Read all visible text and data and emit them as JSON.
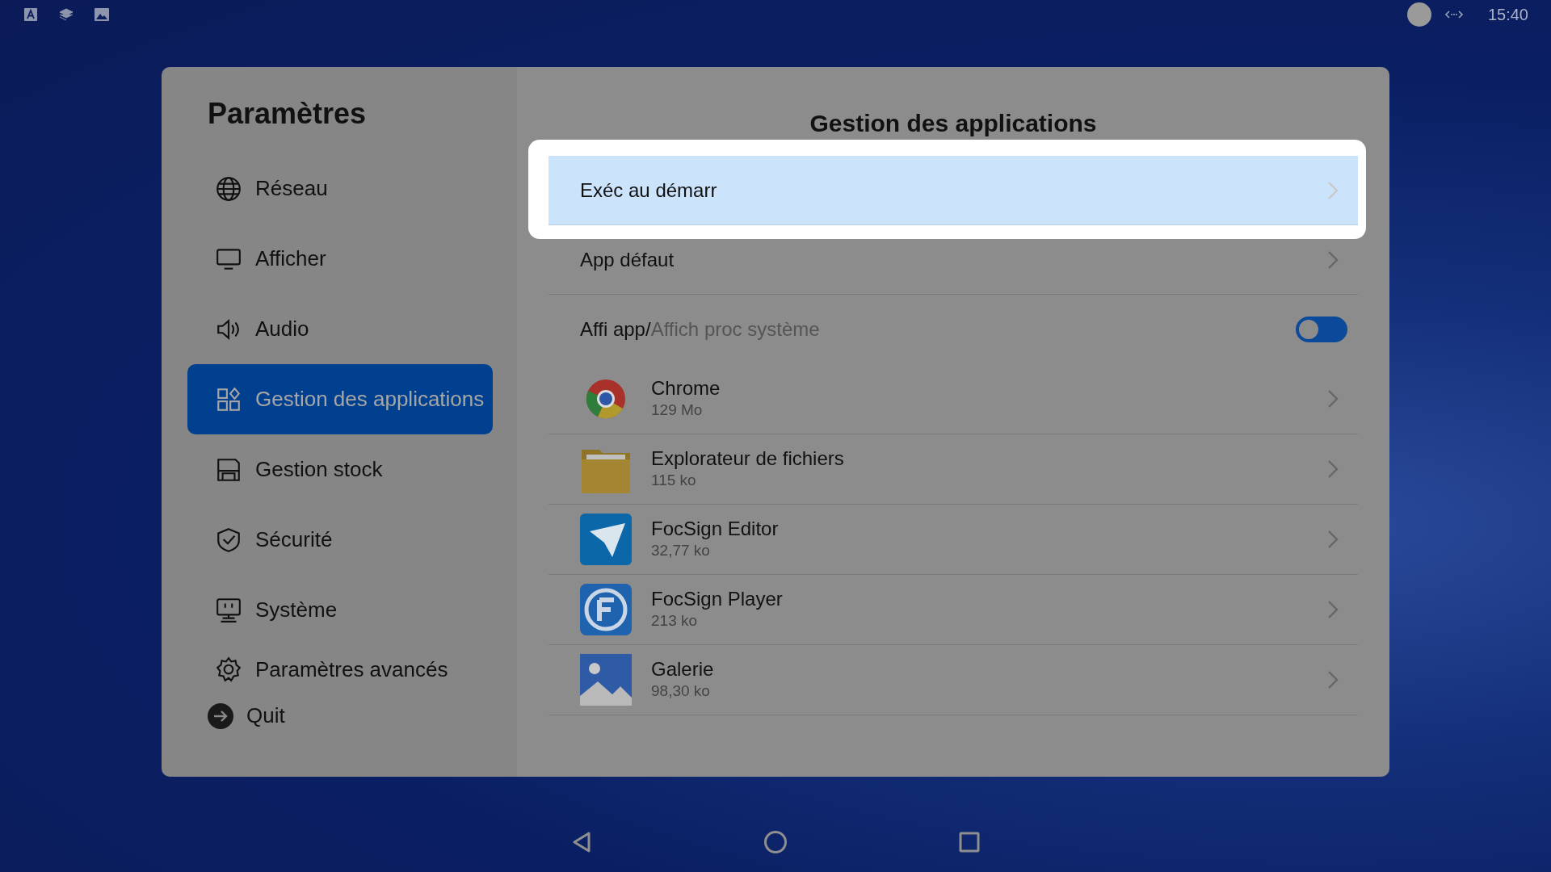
{
  "status_bar": {
    "time": "15:40"
  },
  "sidebar": {
    "title": "Paramètres",
    "items": [
      {
        "label": "Réseau",
        "selected": false
      },
      {
        "label": "Afficher",
        "selected": false
      },
      {
        "label": "Audio",
        "selected": false
      },
      {
        "label": "Gestion des applications",
        "selected": true
      },
      {
        "label": "Gestion stock",
        "selected": false
      },
      {
        "label": "Sécurité",
        "selected": false
      },
      {
        "label": "Système",
        "selected": false
      },
      {
        "label": "Paramètres avancés",
        "selected": false
      }
    ],
    "quit": "Quit"
  },
  "main": {
    "title": "Gestion des applications",
    "rows": [
      {
        "kind": "link",
        "label": "Exéc au démarr",
        "highlighted": true
      },
      {
        "kind": "link",
        "label": "App défaut",
        "highlighted": false
      },
      {
        "kind": "toggle",
        "label": "Affi app/",
        "sublabel": "Affich proc système",
        "on": false
      }
    ],
    "apps": [
      {
        "name": "Chrome",
        "size": "129 Mo"
      },
      {
        "name": "Explorateur de fichiers",
        "size": "115 ko"
      },
      {
        "name": "FocSign Editor",
        "size": "32,77 ko"
      },
      {
        "name": "FocSign Player",
        "size": "213 ko"
      },
      {
        "name": "Galerie",
        "size": "98,30 ko"
      }
    ]
  }
}
